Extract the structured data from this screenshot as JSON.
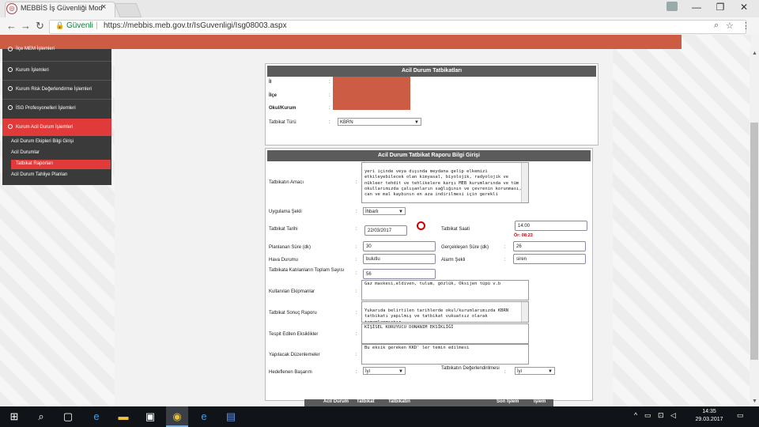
{
  "browser": {
    "tab_title": "MEBBİS İş Güvenliği Mod",
    "tab_close": "×",
    "secure_label": "Güvenli",
    "url_sep": "|",
    "url": "https://mebbis.meb.gov.tr/IsGuvenligi/Isg08003.aspx",
    "window_controls": [
      "—",
      "❐",
      "✕"
    ]
  },
  "sidebar": {
    "items": [
      {
        "label": "İlçe MEM İşlemleri"
      },
      {
        "label": "Kurum İşlemleri"
      },
      {
        "label": "Kurum Risk Değerlendirme İşlemleri"
      },
      {
        "label": "İSG Profesyonelleri İşlemleri"
      },
      {
        "label": "Kurum Acil Durum İşlemleri",
        "active": true
      }
    ],
    "sub_items": [
      {
        "label": "Acil Durum Ekipleri Bilgi Girişi"
      },
      {
        "label": "Acil Durumlar"
      },
      {
        "label": "Tatbikat Raporları",
        "active": true
      },
      {
        "label": "Acil Durum Tahliye Planları"
      }
    ]
  },
  "panel1": {
    "title": "Acil Durum Tatbikatları",
    "il_label": "İl",
    "ilce_label": "İlçe",
    "okul_label": "Okul/Kurum",
    "tatbikat_turu_label": "Tatbikat Türü",
    "tatbikat_turu_value": "KBRN",
    "colon": ":"
  },
  "panel2": {
    "title": "Acil Durum Tatbikat Raporu Bilgi Girişi",
    "amaci_label": "Tatbikatın Amacı",
    "amaci_value": "yeri içinde veya dışında meydana gelip elkemizi etkileyebilecek olan kimyasal, biyolojik, radyolojik ve nükleer tehdit ve tehlikelere karşı MEB kurumlarında ve tüm okullarımızda çalışanların sağlığının ve çevrenin korunması, can ve mal kaybının en aza indirilmesi için gerekli",
    "uygulama_label": "Uygulama Şekli",
    "uygulama_value": "İhbarlı",
    "tarih_label": "Tatbikat Tarihi",
    "tarih_value": "22/03/2017",
    "saat_label": "Tatbikat Saati",
    "saat_value": "14:00",
    "saat_note": "Ör: 08:23",
    "planlanan_label": "Planlanan Süre (dk)",
    "planlanan_value": "30",
    "gerceklesen_label": "Gerçekleşen Süre (dk)",
    "gerceklesen_value": "26",
    "hava_label": "Hava Durumu",
    "hava_value": "bulutlu",
    "alarm_label": "Alarm Şekli",
    "alarm_value": "siren",
    "katilan_label": "Tatbikata Katılanların Toplam Sayısı",
    "katilan_value": "56",
    "ekipman_label": "Kullanılan Ekipmanlar",
    "ekipman_value": "Gaz maskesi,eldiven, tulum, gözlük, Oksijen tüpü v.b",
    "sonuc_label": "Tatbikat Sonuç Raporu",
    "sonuc_value": "Yukarıda belirtilen tarihlerde okul/kurumlarımızda KBRN tatbikatı yapılmış ve tatbikat vukuatsız olarak tamamlanmıştır.",
    "eksik_label": "Tespit Edilen Eksiklikler",
    "eksik_value": "KİŞİSEL KORUYUCU DONANIM EKSİKLİĞİ",
    "duzenleme_label": "Yapılacak Düzenlemeler",
    "duzenleme_value": "Bu eksik gereken KKD' ler temin edilmesi",
    "hedef_label": "Hedeflenen Başarım",
    "hedef_value": "İyi",
    "degerlendirme_label": "Tatbikatın Değerlendirilmesi",
    "degerlendirme_value": "İyi",
    "colon": ":"
  },
  "table_header": [
    "Acil Durum",
    "Tatbikat",
    "Tatbikatın",
    "Son İşlem",
    "İşlem"
  ],
  "taskbar": {
    "time": "14:35",
    "date": "29.03.2017"
  }
}
